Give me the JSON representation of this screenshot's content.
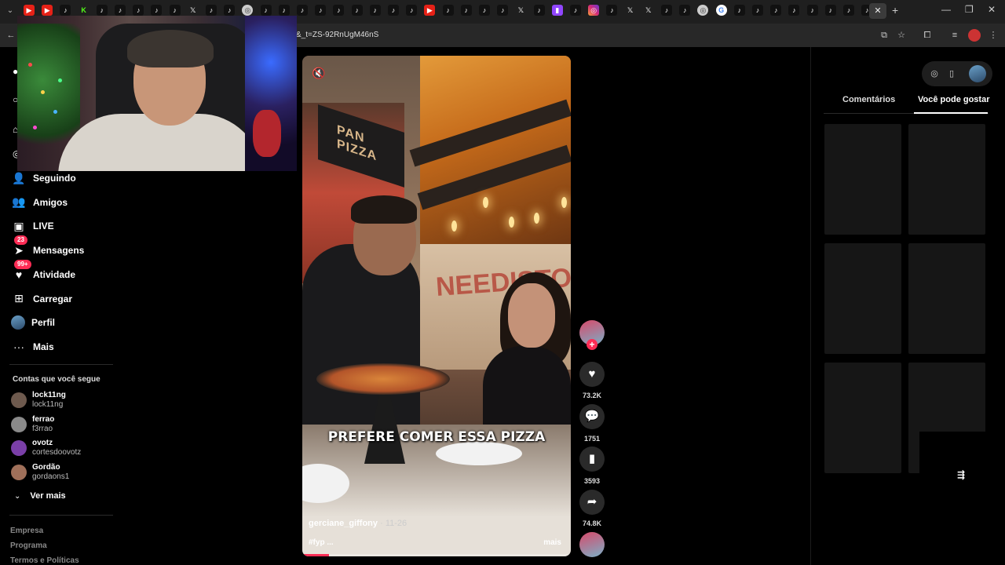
{
  "browser": {
    "url": "&_t=ZS-92RnUgM46nS",
    "tabs": [
      {
        "type": "youtube",
        "glyph": "▶"
      },
      {
        "type": "youtube",
        "glyph": "▶"
      },
      {
        "type": "tiktok",
        "glyph": "♪"
      },
      {
        "type": "kick",
        "glyph": "K"
      },
      {
        "type": "tiktok",
        "glyph": "♪"
      },
      {
        "type": "tiktok",
        "glyph": "♪"
      },
      {
        "type": "tiktok",
        "glyph": "♪"
      },
      {
        "type": "tiktok",
        "glyph": "♪"
      },
      {
        "type": "tiktok",
        "glyph": "♪"
      },
      {
        "type": "x",
        "glyph": "𝕏"
      },
      {
        "type": "tiktok",
        "glyph": "♪"
      },
      {
        "type": "tiktok",
        "glyph": "♪"
      },
      {
        "type": "chrome",
        "glyph": "◎"
      },
      {
        "type": "tiktok",
        "glyph": "♪"
      },
      {
        "type": "tiktok",
        "glyph": "♪"
      },
      {
        "type": "tiktok",
        "glyph": "♪"
      },
      {
        "type": "tiktok",
        "glyph": "♪"
      },
      {
        "type": "tiktok",
        "glyph": "♪"
      },
      {
        "type": "tiktok",
        "glyph": "♪"
      },
      {
        "type": "tiktok",
        "glyph": "♪"
      },
      {
        "type": "tiktok",
        "glyph": "♪"
      },
      {
        "type": "tiktok",
        "glyph": "♪"
      },
      {
        "type": "youtube",
        "glyph": "▶"
      },
      {
        "type": "tiktok",
        "glyph": "♪"
      },
      {
        "type": "tiktok",
        "glyph": "♪"
      },
      {
        "type": "tiktok",
        "glyph": "♪"
      },
      {
        "type": "tiktok",
        "glyph": "♪"
      },
      {
        "type": "x",
        "glyph": "𝕏"
      },
      {
        "type": "tiktok",
        "glyph": "♪"
      },
      {
        "type": "twitch",
        "glyph": "▮"
      },
      {
        "type": "tiktok",
        "glyph": "♪"
      },
      {
        "type": "insta",
        "glyph": "◎"
      },
      {
        "type": "tiktok",
        "glyph": "♪"
      },
      {
        "type": "x",
        "glyph": "𝕏"
      },
      {
        "type": "x",
        "glyph": "𝕏"
      },
      {
        "type": "tiktok",
        "glyph": "♪"
      },
      {
        "type": "tiktok",
        "glyph": "♪"
      },
      {
        "type": "chrome",
        "glyph": "◎"
      },
      {
        "type": "google",
        "glyph": "G"
      },
      {
        "type": "tiktok",
        "glyph": "♪"
      },
      {
        "type": "tiktok",
        "glyph": "♪"
      },
      {
        "type": "tiktok",
        "glyph": "♪"
      },
      {
        "type": "tiktok",
        "glyph": "♪"
      },
      {
        "type": "tiktok",
        "glyph": "♪"
      },
      {
        "type": "tiktok",
        "glyph": "♪"
      },
      {
        "type": "tiktok",
        "glyph": "♪"
      },
      {
        "type": "tiktok",
        "glyph": "♪"
      }
    ],
    "active_tab_glyph": "✕",
    "new_tab_glyph": "+",
    "window_buttons": [
      "—",
      "❐",
      "✕"
    ]
  },
  "sidebar": {
    "nav": [
      {
        "key": "following",
        "label": "Seguindo",
        "icon": "following-icon",
        "glyph": "👤"
      },
      {
        "key": "friends",
        "label": "Amigos",
        "icon": "friends-icon",
        "glyph": "👥"
      },
      {
        "key": "live",
        "label": "LIVE",
        "icon": "live-icon",
        "glyph": "▣"
      },
      {
        "key": "messages",
        "label": "Mensagens",
        "icon": "messages-icon",
        "glyph": "➤",
        "badge": "23"
      },
      {
        "key": "activity",
        "label": "Atividade",
        "icon": "activity-icon",
        "glyph": "♥",
        "badge": "99+"
      },
      {
        "key": "upload",
        "label": "Carregar",
        "icon": "upload-icon",
        "glyph": "⊞"
      },
      {
        "key": "profile",
        "label": "Perfil",
        "icon": "profile-avatar",
        "glyph": ""
      },
      {
        "key": "more",
        "label": "Mais",
        "icon": "more-icon",
        "glyph": "···"
      }
    ],
    "following_title": "Contas que você segue",
    "accounts": [
      {
        "name": "lock11ng",
        "handle": "lock11ng",
        "color": "#6e5a4e"
      },
      {
        "name": "ferrao",
        "handle": "f3rrao",
        "color": "#8a8a8a"
      },
      {
        "name": "ovotz",
        "handle": "cortesdoovotz",
        "color": "#7a3fa8"
      },
      {
        "name": "Gordão",
        "handle": "gordaons1",
        "color": "#a0705a"
      }
    ],
    "see_more": "Ver mais",
    "footer": [
      "Empresa",
      "Programa",
      "Termos e Políticas"
    ]
  },
  "video": {
    "caption": "PREFERE COMER ESSA PIZZA",
    "author": "gerciane_giffony",
    "date": "· 11-26",
    "tag": "#fyp ...",
    "more": "mais",
    "sign_text": "PAN PIZZA",
    "mural_text": "NEEDISTO",
    "progress": 0.1
  },
  "actions": {
    "likes": "73.2K",
    "comments": "1751",
    "saves": "3593",
    "shares": "74.8K"
  },
  "right_panel": {
    "tabs": [
      "Comentários",
      "Você pode gostar"
    ],
    "active_tab": "Você pode gostar"
  },
  "colors": {
    "accent": "#fe2c55",
    "background": "#000000",
    "chrome_bg": "#1f1f1f"
  }
}
